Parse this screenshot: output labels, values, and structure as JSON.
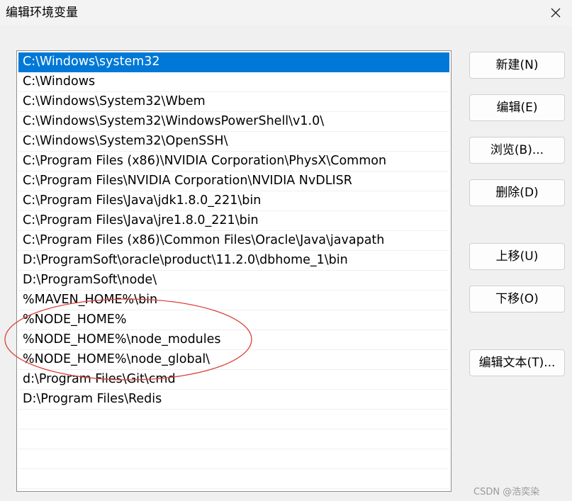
{
  "window": {
    "title": "编辑环境变量",
    "close_icon": "close-icon"
  },
  "path_list": [
    "C:\\Windows\\system32",
    "C:\\Windows",
    "C:\\Windows\\System32\\Wbem",
    "C:\\Windows\\System32\\WindowsPowerShell\\v1.0\\",
    "C:\\Windows\\System32\\OpenSSH\\",
    "C:\\Program Files (x86)\\NVIDIA Corporation\\PhysX\\Common",
    "C:\\Program Files\\NVIDIA Corporation\\NVIDIA NvDLISR",
    "C:\\Program Files\\Java\\jdk1.8.0_221\\bin",
    "C:\\Program Files\\Java\\jre1.8.0_221\\bin",
    "C:\\Program Files (x86)\\Common Files\\Oracle\\Java\\javapath",
    "D:\\ProgramSoft\\oracle\\product\\11.2.0\\dbhome_1\\bin",
    "D:\\ProgramSoft\\node\\",
    "%MAVEN_HOME%\\bin",
    "%NODE_HOME%",
    "%NODE_HOME%\\node_modules",
    "%NODE_HOME%\\node_global\\",
    "d:\\Program Files\\Git\\cmd",
    "D:\\Program Files\\Redis"
  ],
  "selected_index": 0,
  "buttons": {
    "new": "新建(N)",
    "edit": "编辑(E)",
    "browse": "浏览(B)...",
    "delete": "删除(D)",
    "move_up": "上移(U)",
    "move_down": "下移(O)",
    "edit_text": "编辑文本(T)..."
  },
  "watermark": "CSDN @浩奕染",
  "colors": {
    "selection": "#0078d7",
    "annotation": "#d9423a"
  }
}
